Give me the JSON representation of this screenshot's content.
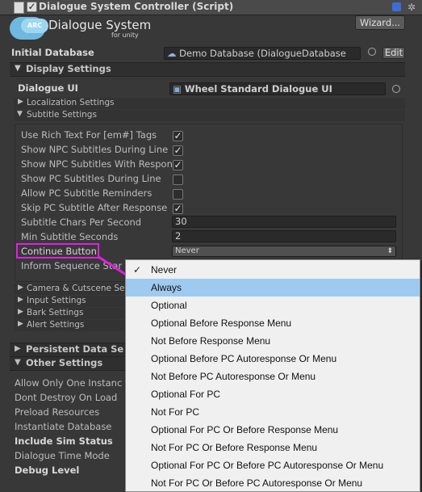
{
  "header": {
    "title": "Dialogue System Controller (Script)",
    "wizard_label": "Wizard..."
  },
  "logo": {
    "line1": "Dialogue System",
    "line2": "for unity",
    "badge": "ARC"
  },
  "initial_database": {
    "label": "Initial Database",
    "value": "Demo Database (DialogueDatabase",
    "edit_label": "Edit"
  },
  "display_settings": {
    "label": "Display Settings",
    "dialogue_ui_label": "Dialogue UI",
    "dialogue_ui_value": "Wheel Standard Dialogue UI",
    "localization_label": "Localization Settings",
    "subtitle_label": "Subtitle Settings",
    "subtitle_rows": [
      {
        "label": "Use Rich Text For [em#] Tags",
        "checked": true
      },
      {
        "label": "Show NPC Subtitles During Line",
        "checked": true
      },
      {
        "label": "Show NPC Subtitles With Respon",
        "checked": true
      },
      {
        "label": "Show PC Subtitles During Line",
        "checked": false
      },
      {
        "label": "Allow PC Subtitle Reminders",
        "checked": false
      },
      {
        "label": "Skip PC Subtitle After Response",
        "checked": true
      }
    ],
    "chars_per_second_label": "Subtitle Chars Per Second",
    "chars_per_second_value": "30",
    "min_seconds_label": "Min Subtitle Seconds",
    "min_seconds_value": "2",
    "continue_button_label": "Continue Button",
    "continue_button_value": "Never",
    "inform_label": "Inform Sequence Star",
    "folds": [
      "Camera & Cutscene Set",
      "Input Settings",
      "Bark Settings",
      "Alert Settings"
    ]
  },
  "persistent_label": "Persistent Data Se",
  "other_settings": {
    "label": "Other Settings",
    "rows": [
      "Allow Only One Instanc",
      "Dont Destroy On Load",
      "Preload Resources",
      "Instantiate Database",
      "Include Sim Status",
      "Dialogue Time Mode",
      "Debug Level"
    ]
  },
  "dropdown": {
    "items": [
      "Never",
      "Always",
      "Optional",
      "Optional Before Response Menu",
      "Not Before Response Menu",
      "Optional Before PC Autoresponse Or Menu",
      "Not Before PC Autoresponse Or Menu",
      "Optional For PC",
      "Not For PC",
      "Optional For PC Or Before Response Menu",
      "Not For PC Or Before Response Menu",
      "Optional For PC Or Before PC Autoresponse Or Menu",
      "Not For PC Or Before PC Autoresponse Or Menu"
    ],
    "checked_item": "Never",
    "highlighted_item": "Always"
  },
  "colors": {
    "annotation": "#e020e0",
    "highlight": "#9fcaf0"
  }
}
